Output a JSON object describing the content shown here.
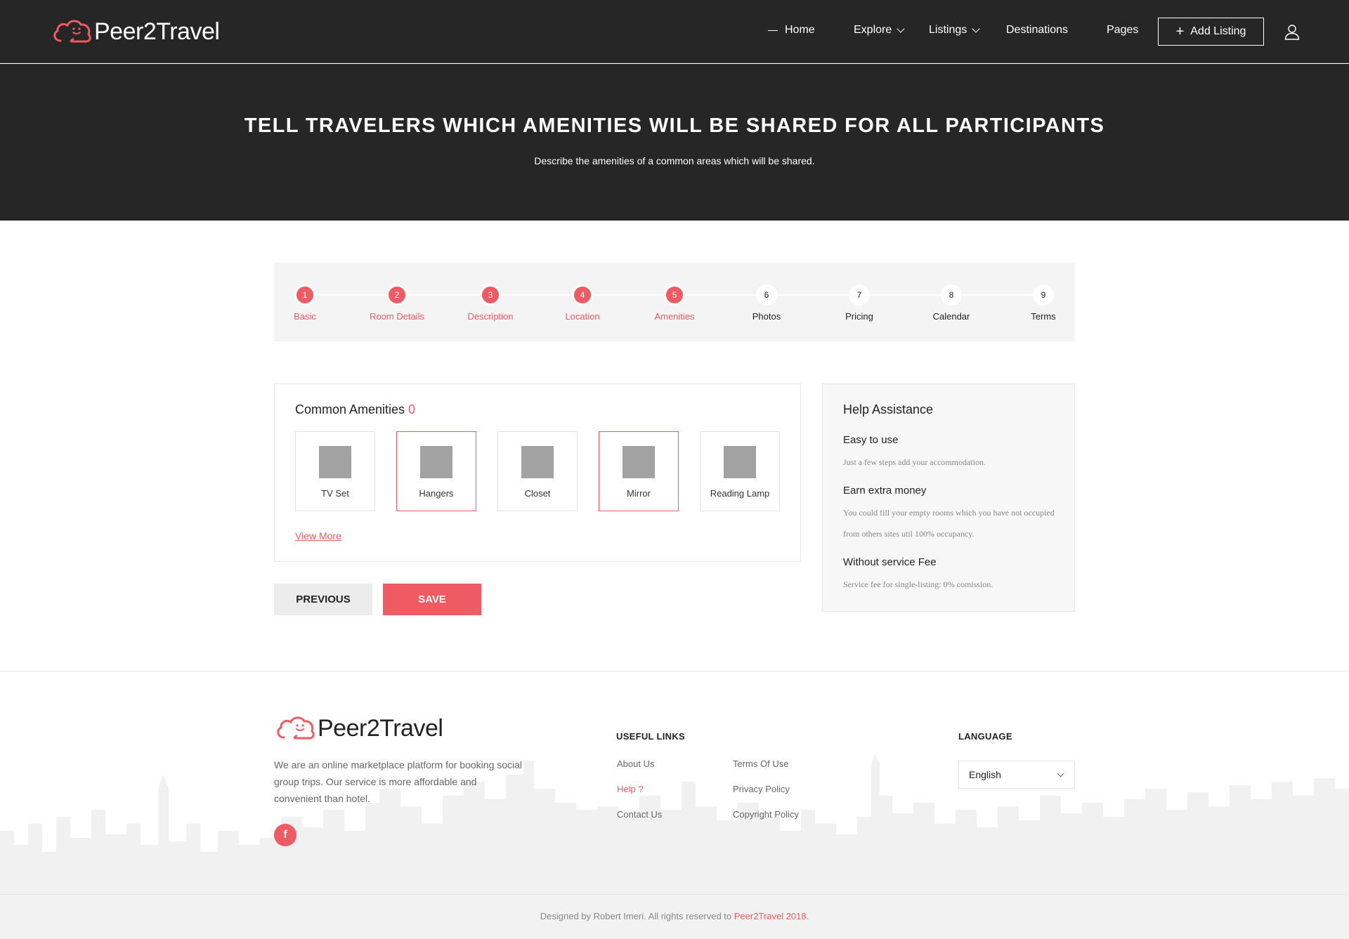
{
  "brand": {
    "name": "Peer2Travel",
    "accent_color": "#f05a63",
    "dark_color": "#262626"
  },
  "nav": {
    "items": [
      {
        "label": "Home",
        "icon": "dash-icon"
      },
      {
        "label": "Explore",
        "icon": "chevron-down-icon"
      },
      {
        "label": "Listings",
        "icon": "chevron-down-icon"
      },
      {
        "label": "Destinations"
      },
      {
        "label": "Pages"
      }
    ],
    "add_listing_label": "Add Listing",
    "user_icon": "user-icon"
  },
  "hero": {
    "title": "TELL TRAVELERS WHICH AMENITIES WILL BE SHARED FOR ALL PARTICIPANTS",
    "subtitle": "Describe the amenities of a common areas which will be shared."
  },
  "steps": [
    {
      "number": "1",
      "label": "Basic",
      "completed": true
    },
    {
      "number": "2",
      "label": "Room Details",
      "completed": true
    },
    {
      "number": "3",
      "label": "Description",
      "completed": true
    },
    {
      "number": "4",
      "label": "Location",
      "completed": true
    },
    {
      "number": "5",
      "label": "Amenities",
      "completed": true
    },
    {
      "number": "6",
      "label": "Photos",
      "completed": false
    },
    {
      "number": "7",
      "label": "Pricing",
      "completed": false
    },
    {
      "number": "8",
      "label": "Calendar",
      "completed": false
    },
    {
      "number": "9",
      "label": "Terms",
      "completed": false
    }
  ],
  "amenities": {
    "title": "Common Amenities",
    "count": "0",
    "items": [
      {
        "label": "TV Set",
        "selected": false
      },
      {
        "label": "Hangers",
        "selected": true
      },
      {
        "label": "Closet",
        "selected": false
      },
      {
        "label": "Mirror",
        "selected": true
      },
      {
        "label": "Reading Lamp",
        "selected": false
      }
    ],
    "view_more_label": "View More"
  },
  "actions": {
    "previous_label": "PREVIOUS",
    "save_label": "SAVE"
  },
  "help": {
    "title": "Help Assistance",
    "sections": [
      {
        "heading": "Easy to use",
        "text": "Just a few steps add your accommodation."
      },
      {
        "heading": "Earn extra money",
        "text": "You could fill your empty rooms which you have not occupied from others sites util 100% occupancy."
      },
      {
        "heading": "Without service Fee",
        "text": "Service fee for single-listing: 0% comission."
      }
    ]
  },
  "footer": {
    "description": "We are an online marketplace platform for booking social group trips. Our service is more affordable and convenient than hotel.",
    "social_icon": "facebook-icon",
    "useful_links_heading": "USEFUL LINKS",
    "links_col1": [
      "About Us",
      "Help ?",
      "Contact Us"
    ],
    "links_col2": [
      "Terms Of Use",
      "Privacy Policy",
      "Copyright Policy"
    ],
    "language_heading": "LANGUAGE",
    "language_value": "English",
    "copyright_text": "Designed by Robert Imeri. All rights reserved to ",
    "copyright_link": "Peer2Travel 2018."
  }
}
